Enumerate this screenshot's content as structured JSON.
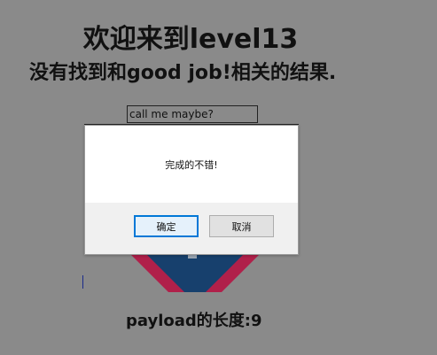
{
  "page": {
    "title": "欢迎来到level13",
    "result_message": "没有找到和good job!相关的结果.",
    "search": {
      "value": "call me maybe?"
    },
    "payload_length": "payload的长度:9"
  },
  "dialog": {
    "message": "完成的不错!",
    "ok_label": "确定",
    "cancel_label": "取消"
  },
  "colors": {
    "background": "#8a8a8a",
    "dialog_body": "#ffffff",
    "dialog_footer": "#f0f0f0",
    "ok_border": "#0078d7",
    "logo_red": "#b0204a",
    "logo_navy": "#17406d"
  }
}
